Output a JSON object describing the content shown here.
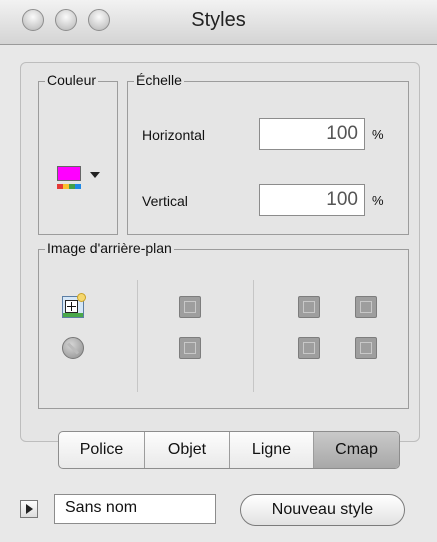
{
  "window": {
    "title": "Styles"
  },
  "couleur": {
    "label": "Couleur",
    "color": "#ff00ff",
    "palette": [
      "#e53935",
      "#fbc02d",
      "#43a047",
      "#1e88e5"
    ]
  },
  "echelle": {
    "label": "Échelle",
    "horizontal": {
      "label": "Horizontal",
      "value": "100",
      "unit": "%"
    },
    "vertical": {
      "label": "Vertical",
      "value": "100",
      "unit": "%"
    }
  },
  "image": {
    "label": "Image d'arrière-plan",
    "icons": [
      "add-image-icon",
      "no-image-icon",
      "tile-top-icon",
      "tile-bottom-icon",
      "stretch-icon",
      "fit-icon",
      "crop-icon",
      "flip-icon"
    ]
  },
  "tabs": [
    {
      "label": "Police",
      "active": false
    },
    {
      "label": "Objet",
      "active": false
    },
    {
      "label": "Ligne",
      "active": false
    },
    {
      "label": "Cmap",
      "active": true
    }
  ],
  "bottom": {
    "style_name": "Sans nom",
    "new_style_label": "Nouveau style"
  }
}
